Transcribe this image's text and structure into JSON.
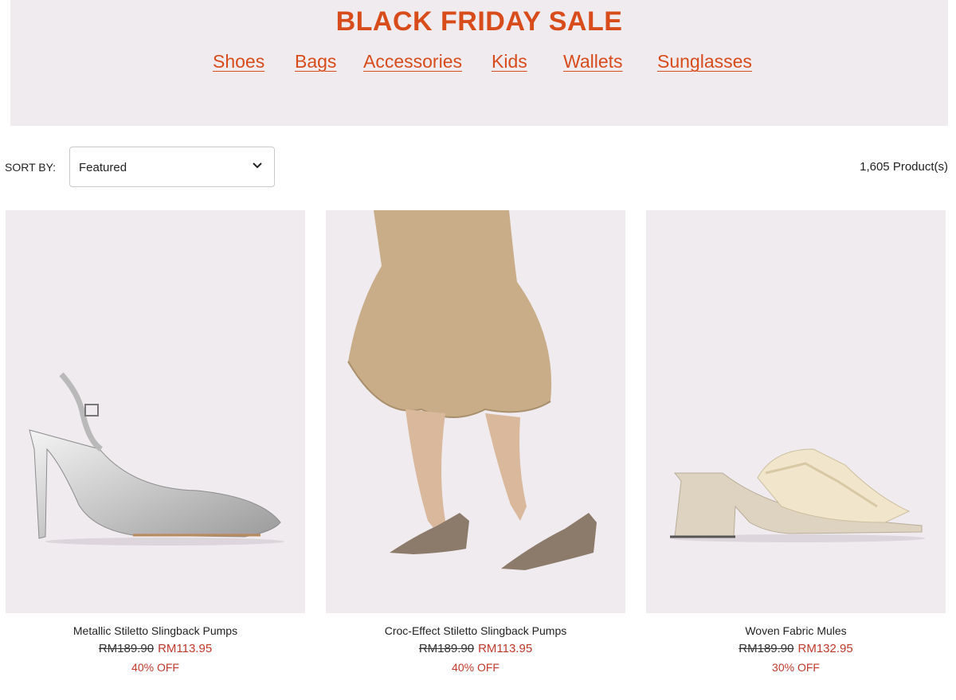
{
  "banner": {
    "title": "BLACK FRIDAY SALE",
    "categories": [
      "Shoes",
      "Bags",
      "Accessories",
      "Kids",
      "Wallets",
      "Sunglasses"
    ]
  },
  "sort": {
    "label": "SORT BY:",
    "selected": "Featured"
  },
  "results": {
    "count_text": "1,605 Product(s)"
  },
  "products": [
    {
      "name": "Metallic Stiletto Slingback Pumps",
      "original_price": "RM189.90",
      "sale_price": "RM113.95",
      "discount": "40% OFF"
    },
    {
      "name": "Croc-Effect Stiletto Slingback Pumps",
      "original_price": "RM189.90",
      "sale_price": "RM113.95",
      "discount": "40% OFF"
    },
    {
      "name": "Woven Fabric Mules",
      "original_price": "RM189.90",
      "sale_price": "RM132.95",
      "discount": "30% OFF"
    }
  ],
  "colors": {
    "accent": "#d84b1a",
    "sale": "#c0392b",
    "banner_bg": "#efebef"
  }
}
